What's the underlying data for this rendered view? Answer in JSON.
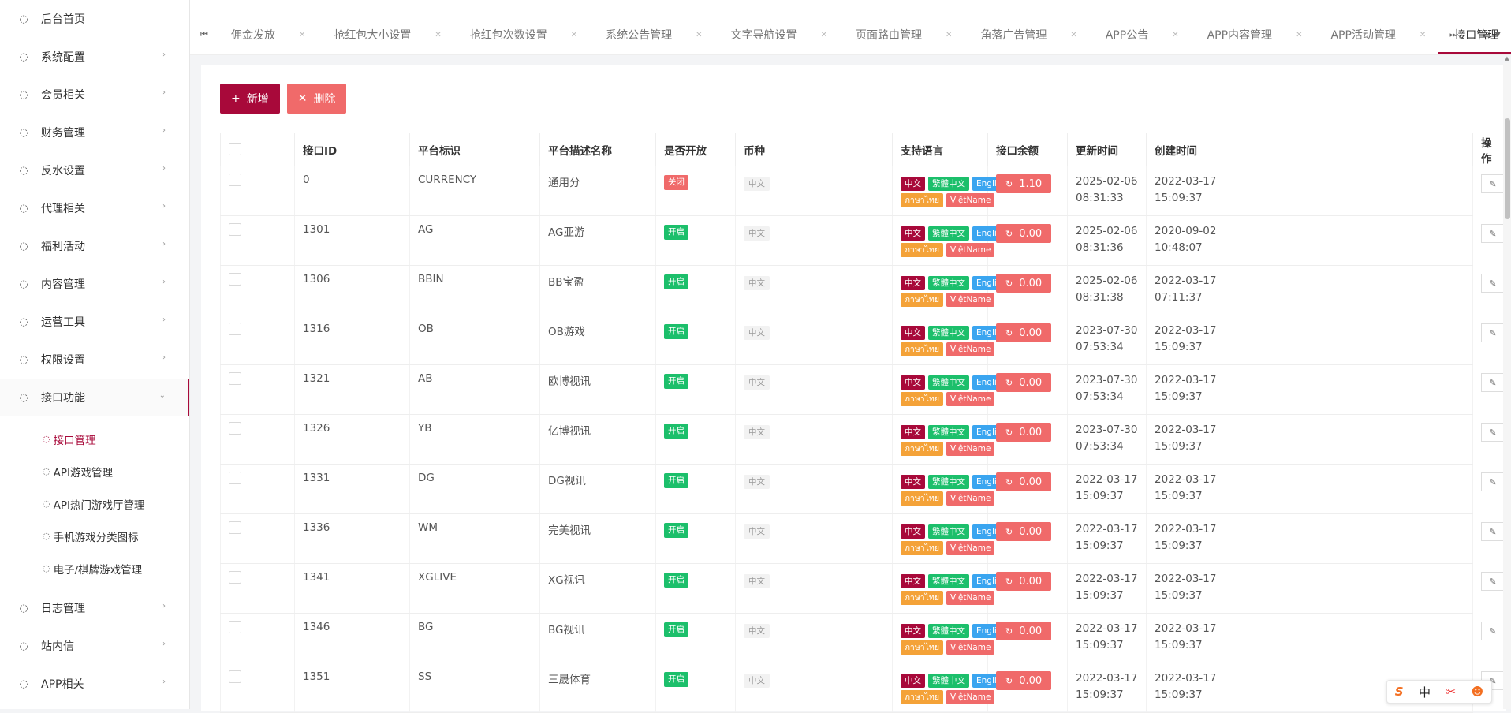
{
  "sidebar": {
    "items": [
      {
        "label": "后台首页",
        "icon": "circle-icon",
        "chevron": false
      },
      {
        "label": "系统配置",
        "icon": "circle-icon",
        "chevron": true
      },
      {
        "label": "会员相关",
        "icon": "circle-icon",
        "chevron": true
      },
      {
        "label": "财务管理",
        "icon": "circle-icon",
        "chevron": true
      },
      {
        "label": "反水设置",
        "icon": "circle-icon",
        "chevron": true
      },
      {
        "label": "代理相关",
        "icon": "circle-icon",
        "chevron": true
      },
      {
        "label": "福利活动",
        "icon": "circle-icon",
        "chevron": true
      },
      {
        "label": "内容管理",
        "icon": "circle-icon",
        "chevron": true
      },
      {
        "label": "运营工具",
        "icon": "circle-icon",
        "chevron": true
      },
      {
        "label": "权限设置",
        "icon": "circle-icon",
        "chevron": true
      },
      {
        "label": "接口功能",
        "icon": "circle-icon",
        "chevron": true,
        "expanded": true
      }
    ],
    "submenu": [
      {
        "label": "接口管理",
        "current": true
      },
      {
        "label": "API游戏管理"
      },
      {
        "label": "API热门游戏厅管理"
      },
      {
        "label": "手机游戏分类图标"
      },
      {
        "label": "电子/棋牌游戏管理"
      }
    ],
    "items_after": [
      {
        "label": "日志管理",
        "chevron": true
      },
      {
        "label": "站内信",
        "chevron": true
      },
      {
        "label": "APP相关",
        "chevron": true
      }
    ]
  },
  "tabs": [
    {
      "label": "佣金发放"
    },
    {
      "label": "抢红包大小设置"
    },
    {
      "label": "抢红包次数设置"
    },
    {
      "label": "系统公告管理"
    },
    {
      "label": "文字导航设置"
    },
    {
      "label": "页面路由管理"
    },
    {
      "label": "角落广告管理"
    },
    {
      "label": "APP公告"
    },
    {
      "label": "APP内容管理"
    },
    {
      "label": "APP活动管理"
    },
    {
      "label": "接口管理",
      "active": true
    }
  ],
  "toolbar": {
    "add_label": "新增",
    "delete_label": "删除"
  },
  "table": {
    "columns": [
      "接口ID",
      "平台标识",
      "平台描述名称",
      "是否开放",
      "币种",
      "支持语言",
      "接口余额",
      "更新时间",
      "创建时间",
      "操作"
    ],
    "languages": [
      "中文",
      "繁體中文",
      "English",
      "ภาษาไทย",
      "ViệtName"
    ],
    "rows": [
      {
        "id": "0",
        "code": "CURRENCY",
        "name": "通用分",
        "status": "关闭",
        "open": false,
        "currency": "中文",
        "balance": "1.10",
        "updated": [
          "2025-02-06",
          "08:31:33"
        ],
        "created": [
          "2022-03-17",
          "15:09:37"
        ]
      },
      {
        "id": "1301",
        "code": "AG",
        "name": "AG亚游",
        "status": "开启",
        "open": true,
        "currency": "中文",
        "balance": "0.00",
        "updated": [
          "2025-02-06",
          "08:31:36"
        ],
        "created": [
          "2020-09-02",
          "10:48:07"
        ]
      },
      {
        "id": "1306",
        "code": "BBIN",
        "name": "BB宝盈",
        "status": "开启",
        "open": true,
        "currency": "中文",
        "balance": "0.00",
        "updated": [
          "2025-02-06",
          "08:31:38"
        ],
        "created": [
          "2022-03-17",
          "07:11:37"
        ]
      },
      {
        "id": "1316",
        "code": "OB",
        "name": "OB游戏",
        "status": "开启",
        "open": true,
        "currency": "中文",
        "balance": "0.00",
        "updated": [
          "2023-07-30",
          "07:53:34"
        ],
        "created": [
          "2022-03-17",
          "15:09:37"
        ]
      },
      {
        "id": "1321",
        "code": "AB",
        "name": "欧博视讯",
        "status": "开启",
        "open": true,
        "currency": "中文",
        "balance": "0.00",
        "updated": [
          "2023-07-30",
          "07:53:34"
        ],
        "created": [
          "2022-03-17",
          "15:09:37"
        ]
      },
      {
        "id": "1326",
        "code": "YB",
        "name": "亿博视讯",
        "status": "开启",
        "open": true,
        "currency": "中文",
        "balance": "0.00",
        "updated": [
          "2023-07-30",
          "07:53:34"
        ],
        "created": [
          "2022-03-17",
          "15:09:37"
        ]
      },
      {
        "id": "1331",
        "code": "DG",
        "name": "DG视讯",
        "status": "开启",
        "open": true,
        "currency": "中文",
        "balance": "0.00",
        "updated": [
          "2022-03-17",
          "15:09:37"
        ],
        "created": [
          "2022-03-17",
          "15:09:37"
        ]
      },
      {
        "id": "1336",
        "code": "WM",
        "name": "完美视讯",
        "status": "开启",
        "open": true,
        "currency": "中文",
        "balance": "0.00",
        "updated": [
          "2022-03-17",
          "15:09:37"
        ],
        "created": [
          "2022-03-17",
          "15:09:37"
        ]
      },
      {
        "id": "1341",
        "code": "XGLIVE",
        "name": "XG视讯",
        "status": "开启",
        "open": true,
        "currency": "中文",
        "balance": "0.00",
        "updated": [
          "2022-03-17",
          "15:09:37"
        ],
        "created": [
          "2022-03-17",
          "15:09:37"
        ]
      },
      {
        "id": "1346",
        "code": "BG",
        "name": "BG视讯",
        "status": "开启",
        "open": true,
        "currency": "中文",
        "balance": "0.00",
        "updated": [
          "2022-03-17",
          "15:09:37"
        ],
        "created": [
          "2022-03-17",
          "15:09:37"
        ]
      },
      {
        "id": "1351",
        "code": "SS",
        "name": "三晟体育",
        "status": "开启",
        "open": true,
        "currency": "中文",
        "balance": "0.00",
        "updated": [
          "2022-03-17",
          "15:09:37"
        ],
        "created": [
          "2022-03-17",
          "15:09:37"
        ]
      }
    ]
  },
  "ime": {
    "logo": "S",
    "mode": "中"
  },
  "colors": {
    "accent": "#a8093a",
    "danger": "#f06a6a",
    "success": "#1cbf6b",
    "info": "#3aa5f0",
    "warning": "#f4a238"
  }
}
